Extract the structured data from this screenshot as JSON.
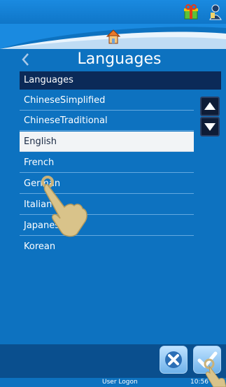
{
  "title": "Languages",
  "list": {
    "header": "Languages",
    "items": [
      {
        "label": "ChineseSimplified",
        "selected": false
      },
      {
        "label": "ChineseTraditional",
        "selected": false
      },
      {
        "label": "English",
        "selected": true
      },
      {
        "label": "French",
        "selected": false
      },
      {
        "label": "German",
        "selected": false
      },
      {
        "label": "Italian",
        "selected": false
      },
      {
        "label": "Japanese",
        "selected": false
      },
      {
        "label": "Korean",
        "selected": false
      }
    ]
  },
  "icons": {
    "status": [
      "gift-icon",
      "user-icon"
    ],
    "nav": [
      "home-icon",
      "back-arrow-icon"
    ],
    "scroll": [
      "scroll-up-icon",
      "scroll-down-icon"
    ],
    "actions": [
      "cancel-icon",
      "confirm-icon"
    ]
  },
  "footer": {
    "user": "User Logon",
    "time": "10:56"
  },
  "colors": {
    "background": "#0d72c0",
    "list_header": "#0b2a58",
    "selected_row": "#f2f4f6"
  }
}
